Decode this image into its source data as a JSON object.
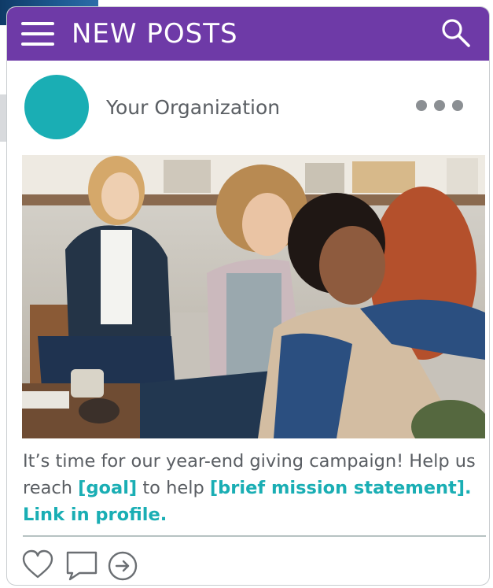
{
  "header": {
    "title": "NEW POSTS",
    "menu_icon": "hamburger-menu-icon",
    "search_icon": "search-icon",
    "accent": "#6e3aa7"
  },
  "post": {
    "author": "Your Organization",
    "avatar_color": "#1aaeb4",
    "more_icon": "more-options-icon",
    "caption_parts": {
      "line_text_1": "It’s time for our year-end giving campaign! Help us reach ",
      "goal": "[goal]",
      "line_text_2": " to help ",
      "mission": "[brief mission statement]. Link in profile."
    },
    "highlight_color": "#1aaeb4",
    "actions": [
      {
        "icon": "heart-icon"
      },
      {
        "icon": "comment-icon"
      },
      {
        "icon": "share-arrow-icon"
      }
    ]
  }
}
